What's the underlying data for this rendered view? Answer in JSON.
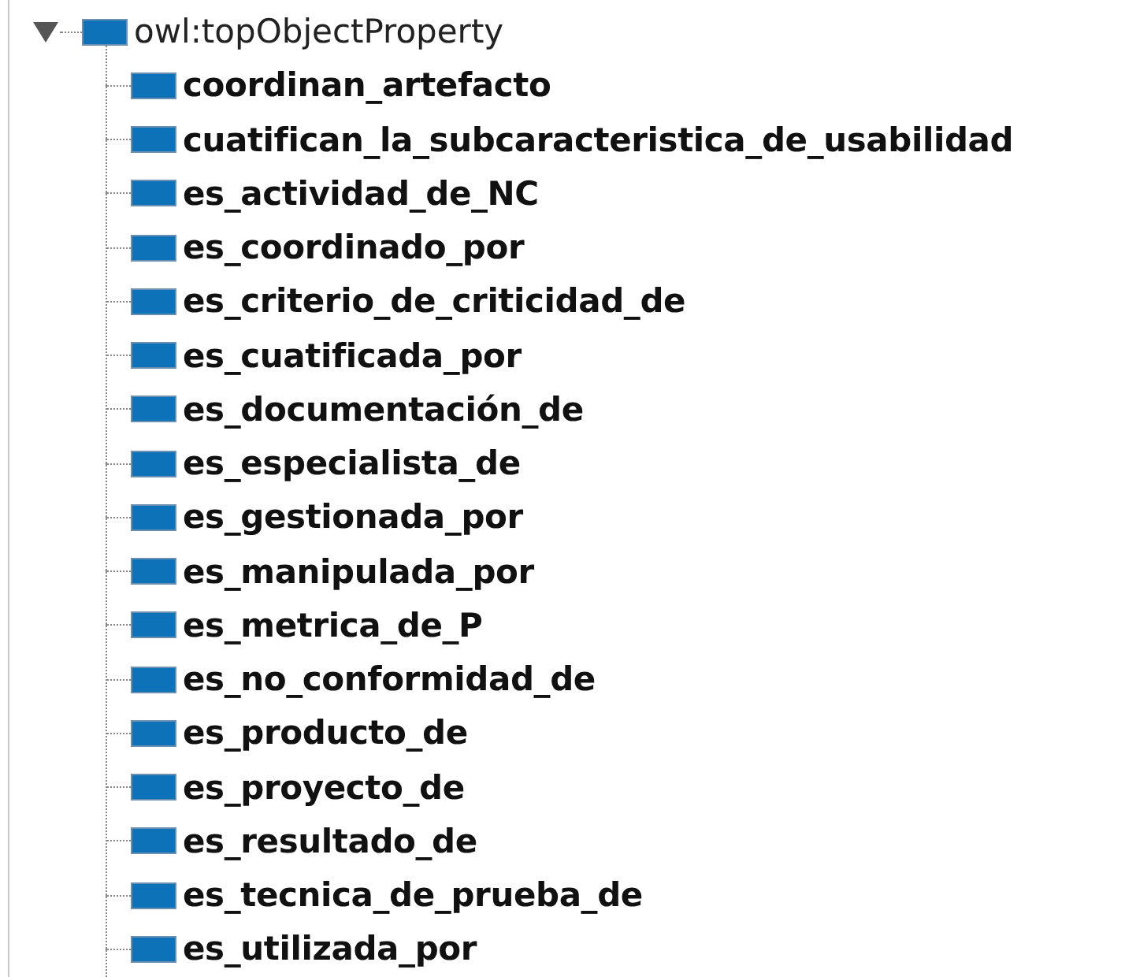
{
  "tree": {
    "label": "owl:topObjectProperty",
    "expanded": true,
    "children": [
      {
        "label": "coordinan_artefacto"
      },
      {
        "label": "cuatifican_la_subcaracteristica_de_usabilidad"
      },
      {
        "label": "es_actividad_de_NC"
      },
      {
        "label": "es_coordinado_por"
      },
      {
        "label": "es_criterio_de_criticidad_de"
      },
      {
        "label": "es_cuatificada_por"
      },
      {
        "label": "es_documentación_de"
      },
      {
        "label": "es_especialista_de"
      },
      {
        "label": "es_gestionada_por"
      },
      {
        "label": "es_manipulada_por"
      },
      {
        "label": "es_metrica_de_P"
      },
      {
        "label": "es_no_conformidad_de"
      },
      {
        "label": "es_producto_de"
      },
      {
        "label": "es_proyecto_de"
      },
      {
        "label": "es_resultado_de"
      },
      {
        "label": "es_tecnica_de_prueba_de"
      },
      {
        "label": "es_utilizada_por"
      }
    ]
  }
}
